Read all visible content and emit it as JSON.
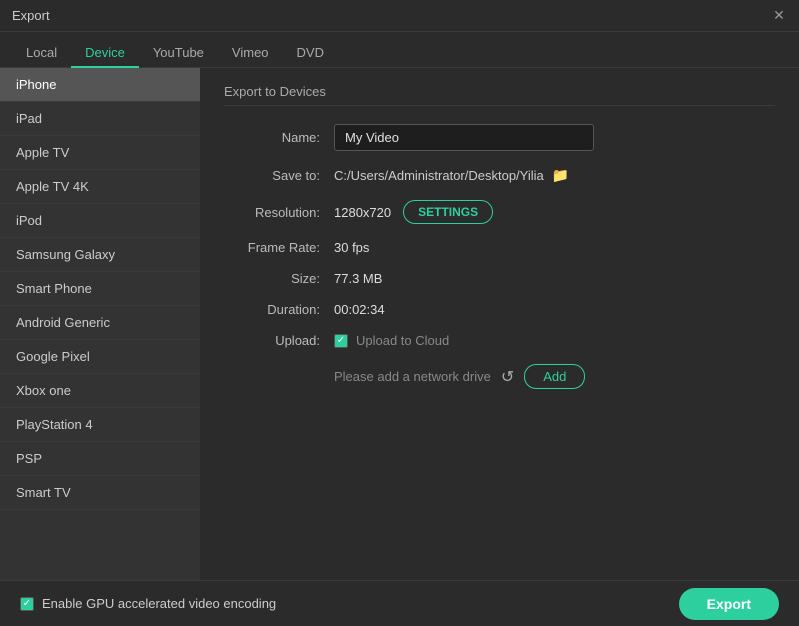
{
  "window": {
    "title": "Export"
  },
  "tabs": [
    {
      "id": "local",
      "label": "Local",
      "active": false
    },
    {
      "id": "device",
      "label": "Device",
      "active": true
    },
    {
      "id": "youtube",
      "label": "YouTube",
      "active": false
    },
    {
      "id": "vimeo",
      "label": "Vimeo",
      "active": false
    },
    {
      "id": "dvd",
      "label": "DVD",
      "active": false
    }
  ],
  "sidebar": {
    "items": [
      {
        "id": "iphone",
        "label": "iPhone",
        "selected": true
      },
      {
        "id": "ipad",
        "label": "iPad",
        "selected": false
      },
      {
        "id": "apple-tv",
        "label": "Apple TV",
        "selected": false
      },
      {
        "id": "apple-tv-4k",
        "label": "Apple TV 4K",
        "selected": false
      },
      {
        "id": "ipod",
        "label": "iPod",
        "selected": false
      },
      {
        "id": "samsung-galaxy",
        "label": "Samsung Galaxy",
        "selected": false
      },
      {
        "id": "smart-phone",
        "label": "Smart Phone",
        "selected": false
      },
      {
        "id": "android-generic",
        "label": "Android Generic",
        "selected": false
      },
      {
        "id": "google-pixel",
        "label": "Google Pixel",
        "selected": false
      },
      {
        "id": "xbox-one",
        "label": "Xbox one",
        "selected": false
      },
      {
        "id": "playstation-4",
        "label": "PlayStation 4",
        "selected": false
      },
      {
        "id": "psp",
        "label": "PSP",
        "selected": false
      },
      {
        "id": "smart-tv",
        "label": "Smart TV",
        "selected": false
      }
    ]
  },
  "panel": {
    "section_title": "Export to Devices",
    "name_label": "Name:",
    "name_value": "My Video",
    "save_to_label": "Save to:",
    "save_to_path": "C:/Users/Administrator/Desktop/Yilia",
    "resolution_label": "Resolution:",
    "resolution_value": "1280x720",
    "settings_button": "SETTINGS",
    "frame_rate_label": "Frame Rate:",
    "frame_rate_value": "30 fps",
    "size_label": "Size:",
    "size_value": "77.3 MB",
    "duration_label": "Duration:",
    "duration_value": "00:02:34",
    "upload_label": "Upload:",
    "upload_cloud_label": "Upload to Cloud",
    "network_message": "Please add a network drive",
    "add_button": "Add"
  },
  "footer": {
    "gpu_label": "Enable GPU accelerated video encoding",
    "export_button": "Export"
  }
}
